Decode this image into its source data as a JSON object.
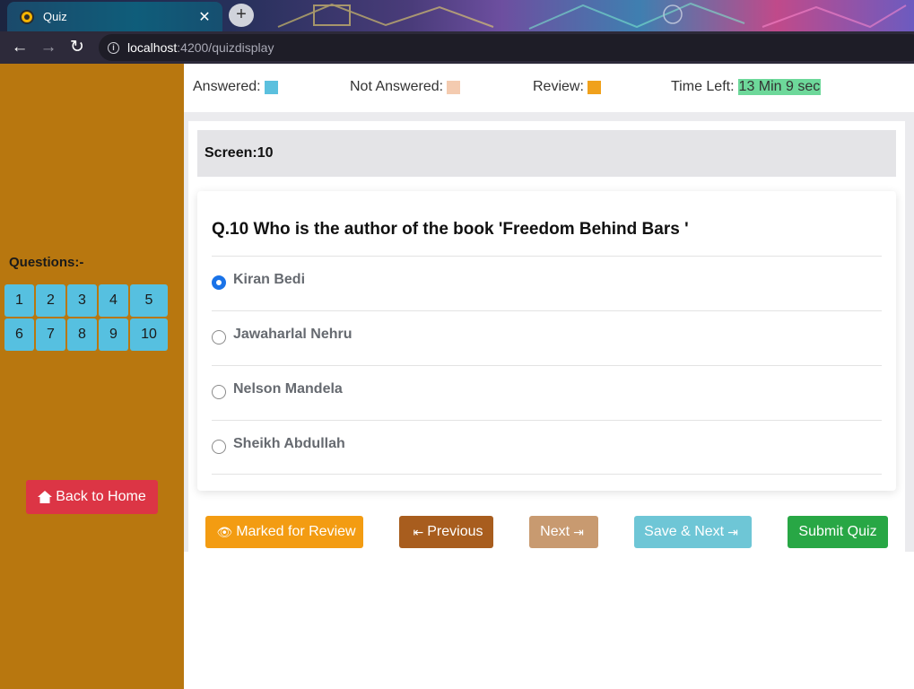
{
  "browser": {
    "tab_title": "Quiz",
    "tab_close": "✕",
    "new_tab": "+",
    "url_host": "localhost",
    "url_rest": ":4200/quizdisplay"
  },
  "legend": {
    "answered_label": "Answered:",
    "answered_color": "#5bc0de",
    "not_answered_label": "Not Answered:",
    "not_answered_color": "#f4cbb0",
    "review_label": "Review:",
    "review_color": "#f0a11c",
    "time_label": "Time Left:",
    "time_value": "13 Min 9 sec"
  },
  "sidebar": {
    "questions_title": "Questions:-",
    "question_numbers": [
      "1",
      "2",
      "3",
      "4",
      "5",
      "6",
      "7",
      "8",
      "9",
      "10"
    ],
    "home_label": "Back to Home"
  },
  "screen": {
    "label": "Screen:10"
  },
  "question": {
    "text": "Q.10 Who is the author of the book 'Freedom Behind Bars '",
    "options": [
      "Kiran Bedi",
      "Jawaharlal Nehru",
      "Nelson Mandela",
      "Sheikh Abdullah"
    ],
    "selected_index": 0
  },
  "actions": {
    "review_label": "Marked for Review",
    "previous_label": "Previous",
    "next_label": "Next",
    "save_next_label": "Save & Next",
    "submit_label": "Submit Quiz"
  },
  "colors": {
    "sidebar_bg": "#b8770f",
    "question_btn": "#56c0e0",
    "home_btn": "#dc3545",
    "review_btn": "#f39c12",
    "previous_btn": "#a85d1e",
    "next_btn": "#c89a70",
    "save_next_btn": "#6ec6d6",
    "submit_btn": "#28a745"
  }
}
